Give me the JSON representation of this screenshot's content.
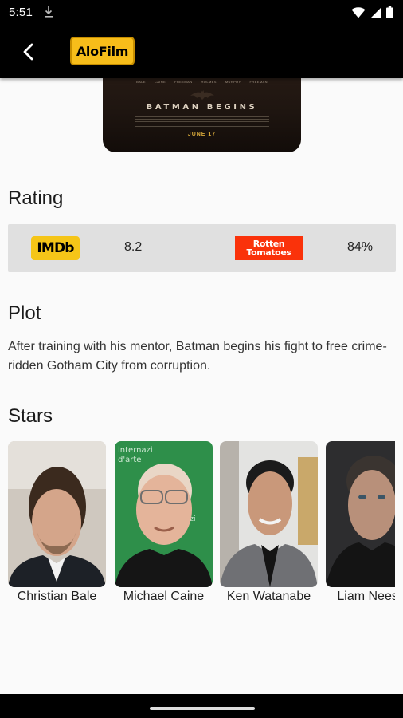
{
  "status_bar": {
    "time": "5:51"
  },
  "app_bar": {
    "logo_text": "AloFilm"
  },
  "poster": {
    "cast_names": [
      "BALE",
      "CAINE",
      "FREEMAN",
      "HOLMES",
      "MURPHY",
      "FREEMAN"
    ],
    "title": "BATMAN BEGINS",
    "date": "JUNE 17"
  },
  "rating": {
    "heading": "Rating",
    "imdb_logo": "IMDb",
    "imdb_value": "8.2",
    "rt_logo_top": "Rotten",
    "rt_logo_bottom": "Tomatoes",
    "rt_value": "84%"
  },
  "plot": {
    "heading": "Plot",
    "text": "After training with his mentor, Batman begins his fight to free crime-ridden Gotham City from corruption."
  },
  "stars": {
    "heading": "Stars",
    "items": [
      {
        "name": "Christian Bale"
      },
      {
        "name": "Michael Caine"
      },
      {
        "name": "Ken Watanabe"
      },
      {
        "name": "Liam Neeson"
      }
    ]
  },
  "colors": {
    "app_bar_bg": "#000000",
    "logo_bg": "#f7bd1a",
    "imdb_yellow": "#f5c518",
    "rt_red": "#fa320a",
    "rating_box_bg": "#e0e0e0"
  }
}
